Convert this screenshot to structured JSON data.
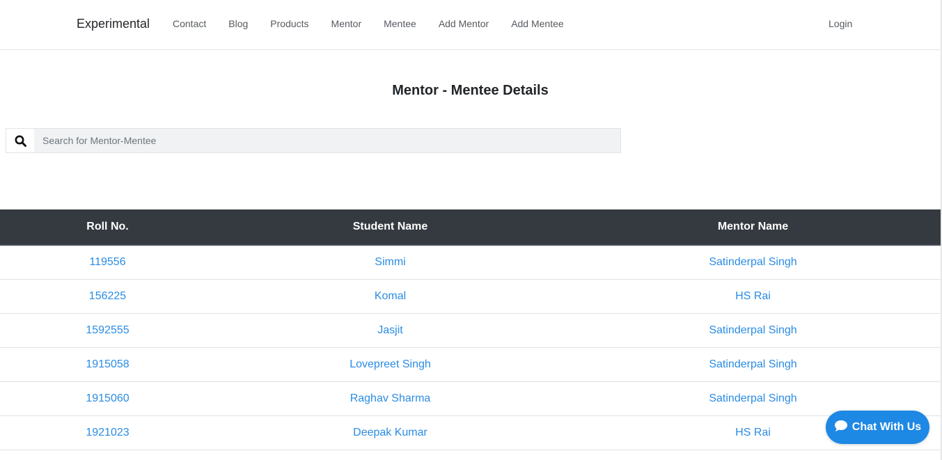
{
  "navbar": {
    "brand": "Experimental",
    "links": [
      "Contact",
      "Blog",
      "Products",
      "Mentor",
      "Mentee",
      "Add Mentor",
      "Add Mentee"
    ],
    "login": "Login"
  },
  "main": {
    "title": "Mentor - Mentee Details"
  },
  "search": {
    "placeholder": "Search for Mentor-Mentee",
    "value": "",
    "icon": "search-icon"
  },
  "table": {
    "headers": [
      "Roll No.",
      "Student Name",
      "Mentor Name"
    ],
    "rows": [
      [
        "119556",
        "Simmi",
        "Satinderpal Singh"
      ],
      [
        "156225",
        "Komal",
        "HS Rai"
      ],
      [
        "1592555",
        "Jasjit",
        "Satinderpal Singh"
      ],
      [
        "1915058",
        "Lovepreet Singh",
        "Satinderpal Singh"
      ],
      [
        "1915060",
        "Raghav Sharma",
        "Satinderpal Singh"
      ],
      [
        "1921023",
        "Deepak Kumar",
        "HS Rai"
      ]
    ]
  },
  "chat": {
    "label": "Chat With Us",
    "icon": "chat-bubble-icon"
  },
  "colors": {
    "header_bg": "#343a40",
    "link": "#2a8ce3",
    "chat_bg": "#1e88e5"
  }
}
